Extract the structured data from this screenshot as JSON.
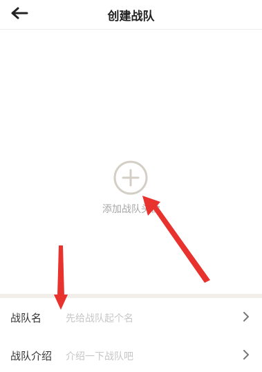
{
  "header": {
    "title": "创建战队",
    "back_icon": "arrow-left-icon"
  },
  "avatar": {
    "add_label": "添加战队头像",
    "icon": "plus-circle-icon"
  },
  "form": {
    "rows": [
      {
        "label": "战队名",
        "placeholder": "先给战队起个名",
        "icon": "chevron-right-icon"
      },
      {
        "label": "战队介绍",
        "placeholder": "介绍一下战队吧",
        "icon": "chevron-right-icon"
      }
    ]
  },
  "colors": {
    "annotation_arrow": "#e8322e",
    "divider": "#f2efea",
    "placeholder": "#c6c6c6"
  }
}
